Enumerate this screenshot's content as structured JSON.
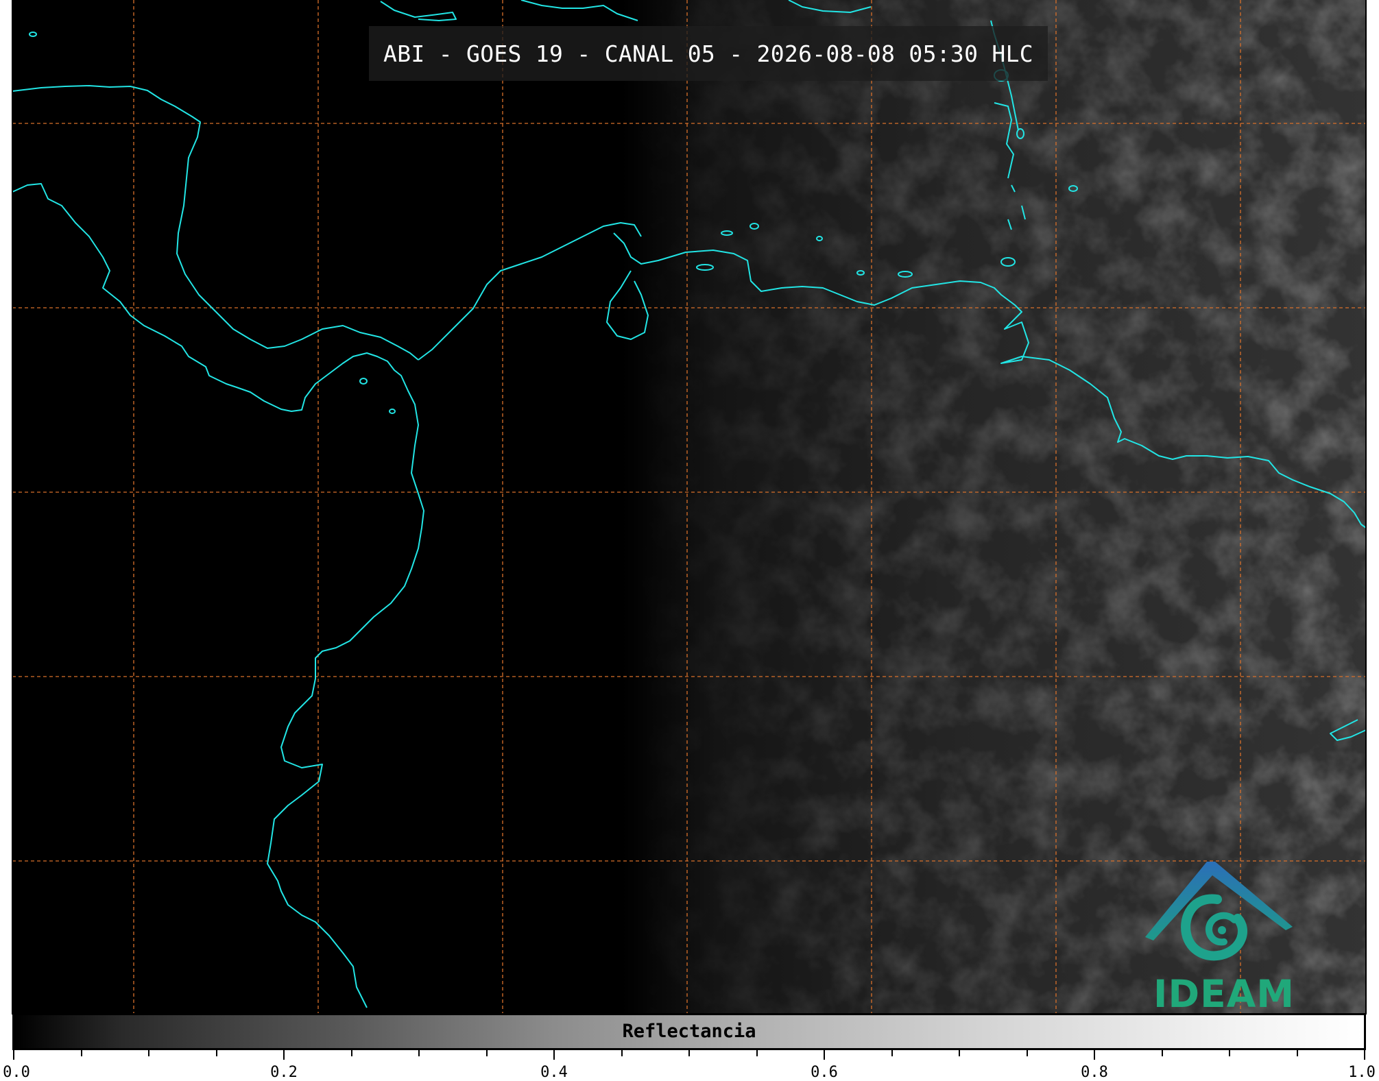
{
  "map": {
    "title": "ABI - GOES 19 - CANAL 05 - 2026-08-08 05:30 HLC",
    "coastline_color": "#22e5e5",
    "grid_color": "#d9702a",
    "background_color": "#000000"
  },
  "logo": {
    "text": "IDEAM",
    "colors": {
      "roof": "#2b6fb8",
      "swirl": "#1ea28c",
      "text": "#20a87a"
    }
  },
  "colorbar": {
    "label": "Reflectancia",
    "range": [
      0.0,
      1.0
    ],
    "tick_labels": [
      "0.0",
      "0.2",
      "0.4",
      "0.6",
      "0.8",
      "1.0"
    ],
    "colormap": "grayscale black-to-white"
  }
}
